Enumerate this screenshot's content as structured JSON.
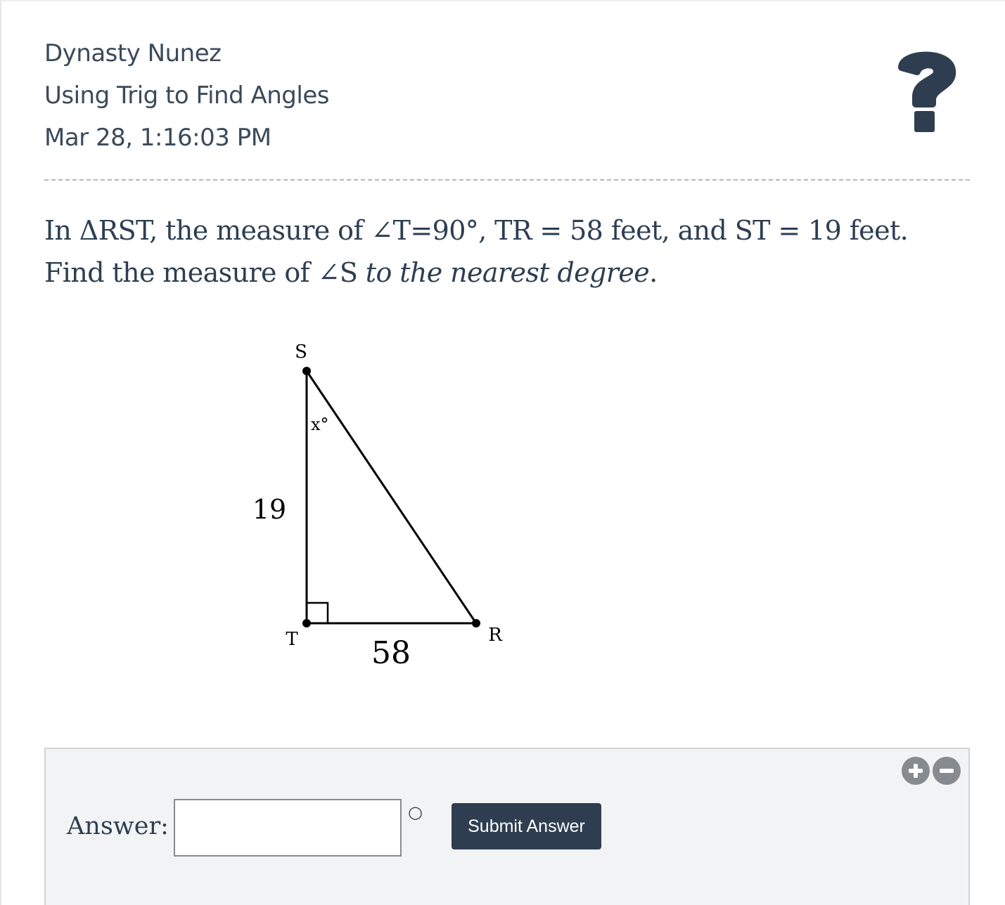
{
  "header": {
    "student_name": "Dynasty Nunez",
    "assignment_title": "Using Trig to Find Angles",
    "timestamp": "Mar 28, 1:16:03 PM",
    "help_icon": "question-mark-icon"
  },
  "question": {
    "part1": "In ΔRST, the measure of ∠T=90°, TR = 58 feet, and ST = 19 feet. Find the measure of ∠S",
    "part2": " to the nearest degree",
    "part3": "."
  },
  "diagram": {
    "vertex_s": "S",
    "vertex_t": "T",
    "vertex_r": "R",
    "angle_label": "x°",
    "side_st": "19",
    "side_tr": "58"
  },
  "answer": {
    "label": "Answer:",
    "input_value": "",
    "unit": "○",
    "submit_label": "Submit Answer"
  },
  "zoom": {
    "in_icon": "plus-circle-icon",
    "out_icon": "minus-circle-icon"
  },
  "colors": {
    "header_text": "#3b4a5a",
    "question_text": "#2d3e50",
    "button_bg": "#2e3e50",
    "panel_bg": "#f2f3f5",
    "zoom_icon": "#868b90"
  }
}
